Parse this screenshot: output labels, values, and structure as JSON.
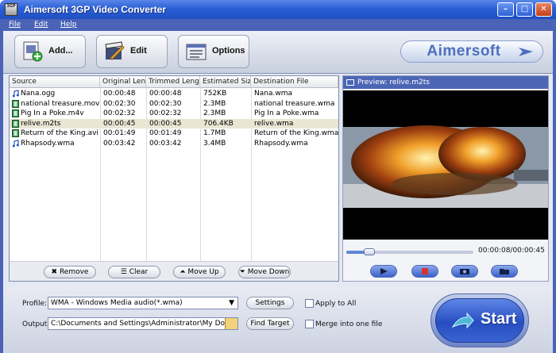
{
  "window": {
    "title": "Aimersoft 3GP Video Converter",
    "icon_label": "3GP",
    "minimize": "–",
    "maximize": "□",
    "close": "✕"
  },
  "menu": [
    "File",
    "Edit",
    "Help"
  ],
  "toolbar": {
    "add_label": "Add...",
    "edit_label": "Edit",
    "options_label": "Options",
    "brand": "Aimersoft"
  },
  "file_list": {
    "columns": [
      "Source",
      "Original Len...",
      "Trimmed Length",
      "Estimated Size",
      "Destination File"
    ],
    "rows": [
      {
        "source": "Nana.ogg",
        "original": "00:00:48",
        "trimmed": "00:00:48",
        "size": "752KB",
        "dest": "Nana.wma",
        "type": "audio"
      },
      {
        "source": "national treasure.mov",
        "original": "00:02:30",
        "trimmed": "00:02:30",
        "size": "2.3MB",
        "dest": "national treasure.wma",
        "type": "video"
      },
      {
        "source": "Pig In a Poke.m4v",
        "original": "00:02:32",
        "trimmed": "00:02:32",
        "size": "2.3MB",
        "dest": "Pig In a Poke.wma",
        "type": "video"
      },
      {
        "source": "relive.m2ts",
        "original": "00:00:45",
        "trimmed": "00:00:45",
        "size": "706.4KB",
        "dest": "relive.wma",
        "type": "video",
        "selected": true
      },
      {
        "source": "Return of the King.avi",
        "original": "00:01:49",
        "trimmed": "00:01:49",
        "size": "1.7MB",
        "dest": "Return of the King.wma",
        "type": "video"
      },
      {
        "source": "Rhapsody.wma",
        "original": "00:03:42",
        "trimmed": "00:03:42",
        "size": "3.4MB",
        "dest": "Rhapsody.wma",
        "type": "audio"
      }
    ],
    "buttons": {
      "remove": "Remove",
      "clear": "Clear",
      "move_up": "Move Up",
      "move_down": "Move Down"
    }
  },
  "preview": {
    "title": "Preview: relive.m2ts",
    "time": "00:00:08/00:00:45",
    "progress": 0.18
  },
  "output": {
    "profile_label": "Profile:",
    "profile_value": "WMA - Windows Media audio(*.wma)",
    "settings_label": "Settings",
    "apply_all_label": "Apply to All",
    "output_label": "Output:",
    "output_value": "C:\\Documents and Settings\\Administrator\\My Documen",
    "find_target_label": "Find Target",
    "merge_label": "Merge into one file",
    "start_label": "Start"
  },
  "colors": {
    "title_blue": "#2a5fd6",
    "frame_blue": "#4a63b7",
    "selected_row": "#e9e6d4"
  }
}
